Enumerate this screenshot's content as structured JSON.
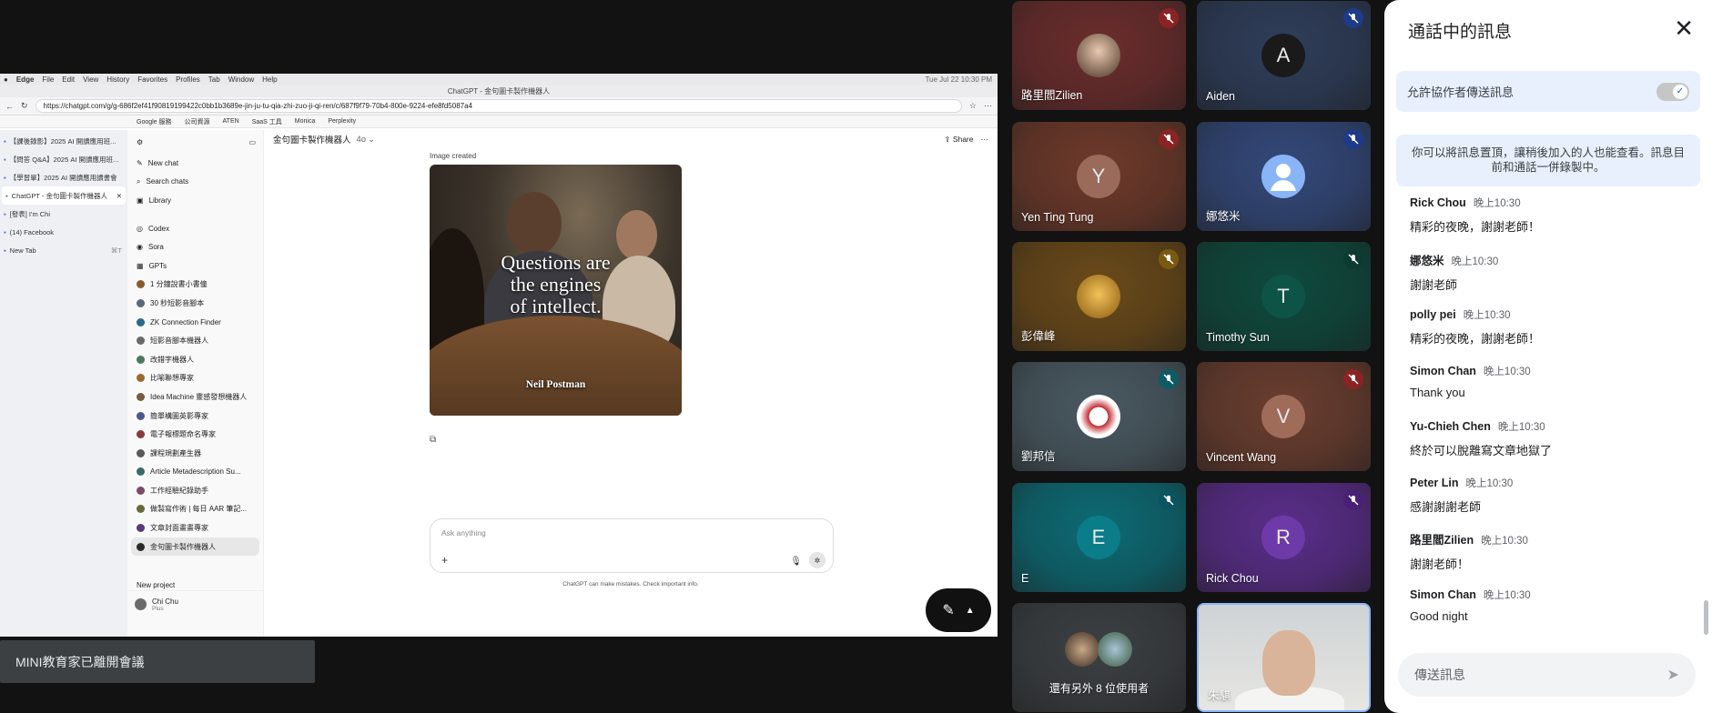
{
  "shared_screen": {
    "mac_menu": [
      "Edge",
      "File",
      "Edit",
      "View",
      "History",
      "Favorites",
      "Profiles",
      "Tab",
      "Window",
      "Help"
    ],
    "clock": "Tue Jul 22  10:30 PM",
    "window_title": "ChatGPT - 金句圖卡製作機器人",
    "url": "https://chatgpt.com/g/g-686f2ef41f90819199422c0bb1b3689e-jin-ju-tu-qia-zhi-zuo-ji-qi-ren/c/687f9f79-70b4-800e-9224-efe8fd5087a4",
    "bookmarks": [
      "Google 服務",
      "公司資源",
      "ATEN",
      "SaaS 工具",
      "Monica",
      "Perplexity"
    ],
    "edge_tabs": [
      {
        "label": "【課後錄影】2025 AI 開讀應用班..."
      },
      {
        "label": "【問答 Q&A】2025 AI 開讀應用班..."
      },
      {
        "label": "【學習單】2025 AI 開讀應用讀書會"
      },
      {
        "label": "ChatGPT - 金句圖卡製作機器人",
        "active": true
      },
      {
        "label": "[發表] I'm Chi"
      },
      {
        "label": "(14) Facebook"
      },
      {
        "label": "New Tab",
        "shortcut": "⌘T"
      }
    ],
    "gpt_nav": {
      "new_chat": "New chat",
      "search": "Search chats",
      "library": "Library",
      "codex": "Codex",
      "sora": "Sora",
      "gpts": "GPTs"
    },
    "gpt_list": [
      "1 分鐘說書小書僮",
      "30 秒短影音腳本",
      "ZK Connection Finder",
      "短影音腳本機器人",
      "改錯字機器人",
      "比喻聯想專家",
      "Idea Machine 靈感發想機器人",
      "簡單構圖英影專家",
      "電子報標題命名專家",
      "課程規劃產生器",
      "Article Metadescription Su...",
      "工作經驗紀錄助手",
      "做製寫作術 | 每日 AAR 筆記...",
      "文章封面畫畫專家",
      "金句圖卡製作機器人"
    ],
    "new_project": "New project",
    "user": {
      "name": "Chi Chu",
      "plan": "Plus"
    },
    "chat_header": {
      "title": "金句圖卡製作機器人",
      "model": "4o",
      "share": "Share"
    },
    "image_label": "Image created",
    "image_quote": [
      "Questions are",
      "the engines",
      "of intellect."
    ],
    "image_author": "Neil Postman",
    "composer_placeholder": "Ask anything",
    "disclaimer": "ChatGPT can make mistakes. Check important info."
  },
  "toast": "MINI教育家已離開會議",
  "participants": [
    {
      "name": "路里閻Zilien",
      "bg": "#6b2d2d",
      "mic": "#8b2323",
      "avatar_type": "photo"
    },
    {
      "name": "Aiden",
      "bg": "#2f3e5a",
      "mic": "#1e3a8a",
      "avatar_type": "letter",
      "initial": "A",
      "avatar_bg": "#1a1a1a"
    },
    {
      "name": "Yen Ting Tung",
      "bg": "#6e3a2b",
      "mic": "#8b2323",
      "avatar_type": "letter",
      "initial": "Y",
      "avatar_bg": "#9a6a5a"
    },
    {
      "name": "娜悠米",
      "bg": "#34497a",
      "mic": "#1e3a8a",
      "avatar_type": "person"
    },
    {
      "name": "彭偉峰",
      "bg": "#6a4a1a",
      "mic": "#7a5a10",
      "avatar_type": "photo"
    },
    {
      "name": "Timothy Sun",
      "bg": "#0f4a3e",
      "mic": "#0c3b31",
      "avatar_type": "letter",
      "initial": "T",
      "avatar_bg": "#0d5446"
    },
    {
      "name": "劉邦信",
      "bg": "#4a5a62",
      "mic": "#0e5b66",
      "avatar_type": "photo"
    },
    {
      "name": "Vincent Wang",
      "bg": "#6a3e30",
      "mic": "#8b2323",
      "avatar_type": "letter",
      "initial": "V",
      "avatar_bg": "#a06c5a"
    },
    {
      "name": "E",
      "bg": "#0e6a74",
      "mic": "#0a5560",
      "avatar_type": "letter",
      "initial": "E",
      "avatar_bg": "#0b7d88"
    },
    {
      "name": "Rick Chou",
      "bg": "#5a2e8a",
      "mic": "#4a1f78",
      "avatar_type": "letter",
      "initial": "R",
      "avatar_bg": "#6e3aa8"
    },
    {
      "name": "還有另外 8 位使用者",
      "bg": "#3c4043",
      "avatar_type": "group"
    },
    {
      "name": "朱騏",
      "bg": "#d8d8d8",
      "avatar_type": "self"
    }
  ],
  "chat_panel": {
    "title": "通話中的訊息",
    "allow_label": "允許協作者傳送訊息",
    "pin_note": "你可以將訊息置頂，讓稍後加入的人也能查看。訊息目前和通話一併錄製中。",
    "messages": [
      {
        "sender": "Rick Chou",
        "time": "晚上10:30",
        "text": "精彩的夜晚，謝謝老師！"
      },
      {
        "sender": "娜悠米",
        "time": "晚上10:30",
        "text": "謝謝老師"
      },
      {
        "sender": "polly pei",
        "time": "晚上10:30",
        "text": "精彩的夜晚，謝謝老師！"
      },
      {
        "sender": "Simon Chan",
        "time": "晚上10:30",
        "text": "Thank you"
      },
      {
        "sender": "Yu-Chieh Chen",
        "time": "晚上10:30",
        "text": "終於可以脫離寫文章地獄了"
      },
      {
        "sender": "Peter Lin",
        "time": "晚上10:30",
        "text": "感謝謝謝老師"
      },
      {
        "sender": "路里閻Zilien",
        "time": "晚上10:30",
        "text": "謝謝老師！"
      },
      {
        "sender": "Simon Chan",
        "time": "晚上10:30",
        "text": "Good night"
      }
    ],
    "send_placeholder": "傳送訊息"
  }
}
